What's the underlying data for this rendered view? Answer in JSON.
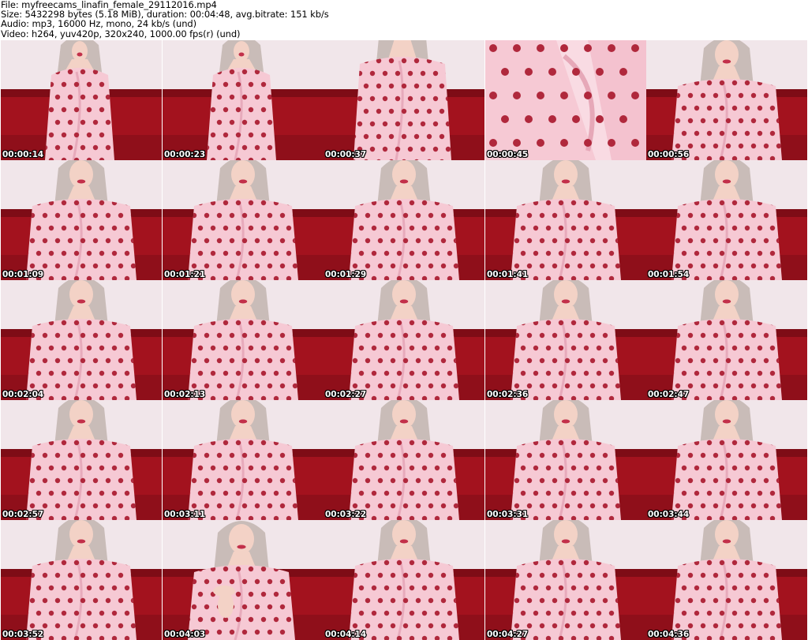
{
  "header": {
    "file": "File: myfreecams_linafin_female_29112016.mp4",
    "size": "Size: 5432298 bytes (5.18 MiB), duration: 00:04:48, avg.bitrate: 151 kb/s",
    "audio": "Audio: mp3, 16000 Hz, mono, 24 kb/s (und)",
    "video": "Video: h264, yuv420p, 320x240, 1000.00 fps(r) (und)"
  },
  "colors": {
    "wall": "#f1e6ea",
    "couch": "#a3121e",
    "couch_dark": "#7e0c16",
    "blanket": "#f6c9d4",
    "dots": "#b0283c",
    "hair": "#c9bcb8",
    "skin": "#f3d2c6",
    "lips": "#c2304a",
    "timestamp_text": "#ffffff"
  },
  "thumbnails": [
    {
      "time": "00:00:14",
      "scene": "wide"
    },
    {
      "time": "00:00:23",
      "scene": "wide"
    },
    {
      "time": "00:00:37",
      "scene": "body"
    },
    {
      "time": "00:00:45",
      "scene": "closeup"
    },
    {
      "time": "00:00:56",
      "scene": "portrait"
    },
    {
      "time": "00:01:09",
      "scene": "portrait"
    },
    {
      "time": "00:01:21",
      "scene": "portrait"
    },
    {
      "time": "00:01:29",
      "scene": "portrait"
    },
    {
      "time": "00:01:41",
      "scene": "portrait"
    },
    {
      "time": "00:01:54",
      "scene": "portrait"
    },
    {
      "time": "00:02:04",
      "scene": "portrait"
    },
    {
      "time": "00:02:13",
      "scene": "portrait"
    },
    {
      "time": "00:02:27",
      "scene": "portrait"
    },
    {
      "time": "00:02:36",
      "scene": "portrait"
    },
    {
      "time": "00:02:47",
      "scene": "portrait"
    },
    {
      "time": "00:02:57",
      "scene": "portrait"
    },
    {
      "time": "00:03:11",
      "scene": "portrait"
    },
    {
      "time": "00:03:22",
      "scene": "portrait"
    },
    {
      "time": "00:03:31",
      "scene": "portrait"
    },
    {
      "time": "00:03:44",
      "scene": "portrait"
    },
    {
      "time": "00:03:52",
      "scene": "portrait"
    },
    {
      "time": "00:04:03",
      "scene": "hands"
    },
    {
      "time": "00:04:14",
      "scene": "portrait"
    },
    {
      "time": "00:04:27",
      "scene": "portrait"
    },
    {
      "time": "00:04:36",
      "scene": "portrait"
    }
  ]
}
